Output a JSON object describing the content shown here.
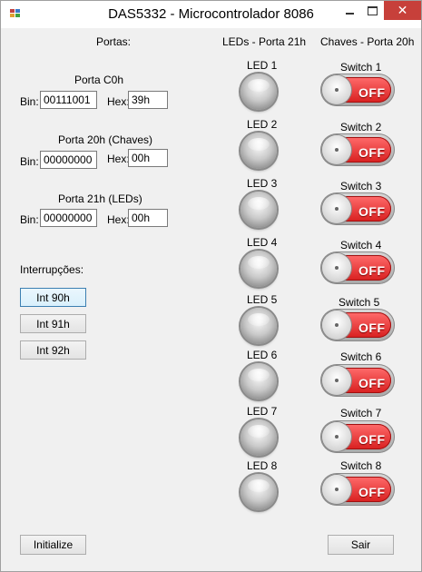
{
  "window": {
    "title": "DAS5332 - Microcontrolador 8086",
    "close_glyph": "✕"
  },
  "headers": {
    "portas": "Portas:",
    "leds": "LEDs - Porta 21h",
    "chaves": "Chaves - Porta 20h"
  },
  "ports": [
    {
      "title": "Porta C0h",
      "bin_label": "Bin:",
      "bin": "00111001",
      "hex_label": "Hex:",
      "hex": "39h"
    },
    {
      "title": "Porta 20h (Chaves)",
      "bin_label": "Bin:",
      "bin": "00000000",
      "hex_label": "Hex:",
      "hex": "00h"
    },
    {
      "title": "Porta 21h (LEDs)",
      "bin_label": "Bin:",
      "bin": "00000000",
      "hex_label": "Hex:",
      "hex": "00h"
    }
  ],
  "interrupts": {
    "label": "Interrupções:",
    "buttons": [
      "Int 90h",
      "Int 91h",
      "Int 92h"
    ]
  },
  "leds": [
    "LED 1",
    "LED 2",
    "LED 3",
    "LED 4",
    "LED 5",
    "LED 6",
    "LED 7",
    "LED 8"
  ],
  "switches": [
    {
      "label": "Switch 1",
      "state": "OFF"
    },
    {
      "label": "Switch 2",
      "state": "OFF"
    },
    {
      "label": "Switch 3",
      "state": "OFF"
    },
    {
      "label": "Switch 4",
      "state": "OFF"
    },
    {
      "label": "Switch 5",
      "state": "OFF"
    },
    {
      "label": "Switch 6",
      "state": "OFF"
    },
    {
      "label": "Switch 7",
      "state": "OFF"
    },
    {
      "label": "Switch 8",
      "state": "OFF"
    }
  ],
  "footer": {
    "initialize": "Initialize",
    "sair": "Sair"
  },
  "colors": {
    "switch_off": "#e53030",
    "close_button": "#c7403a",
    "focus_border": "#3c7fb1"
  }
}
